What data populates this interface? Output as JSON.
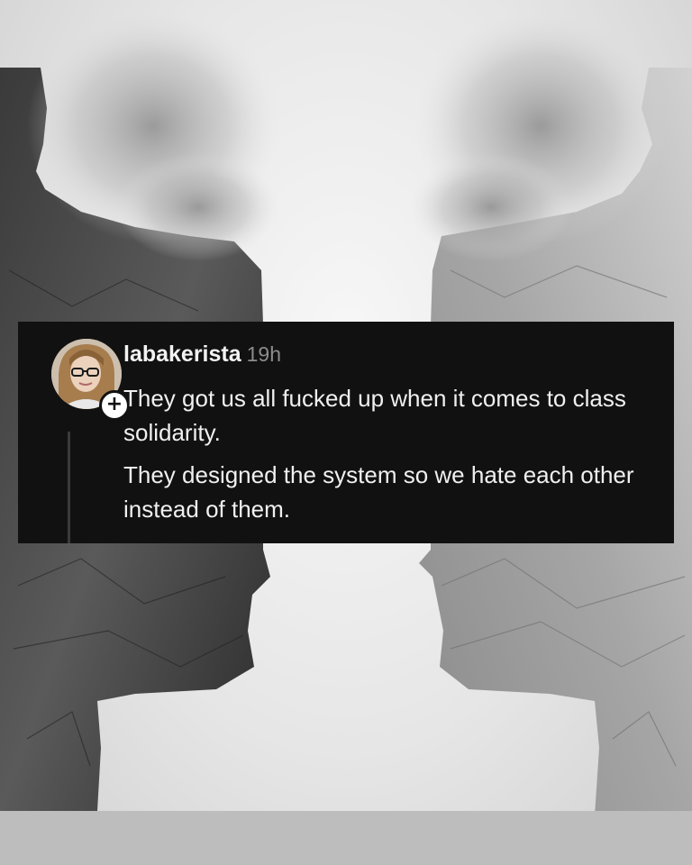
{
  "post": {
    "username": "labakerista",
    "timestamp": "19h",
    "paragraphs": [
      "They got us all fucked up when it comes to class solidarity.",
      "They designed the system so we hate each other instead of them."
    ]
  },
  "icons": {
    "follow_badge": "+",
    "avatar": "profile-photo"
  },
  "colors": {
    "card_background": "#111111",
    "text": "#f0f0f0",
    "timestamp": "#8c8c8c"
  }
}
